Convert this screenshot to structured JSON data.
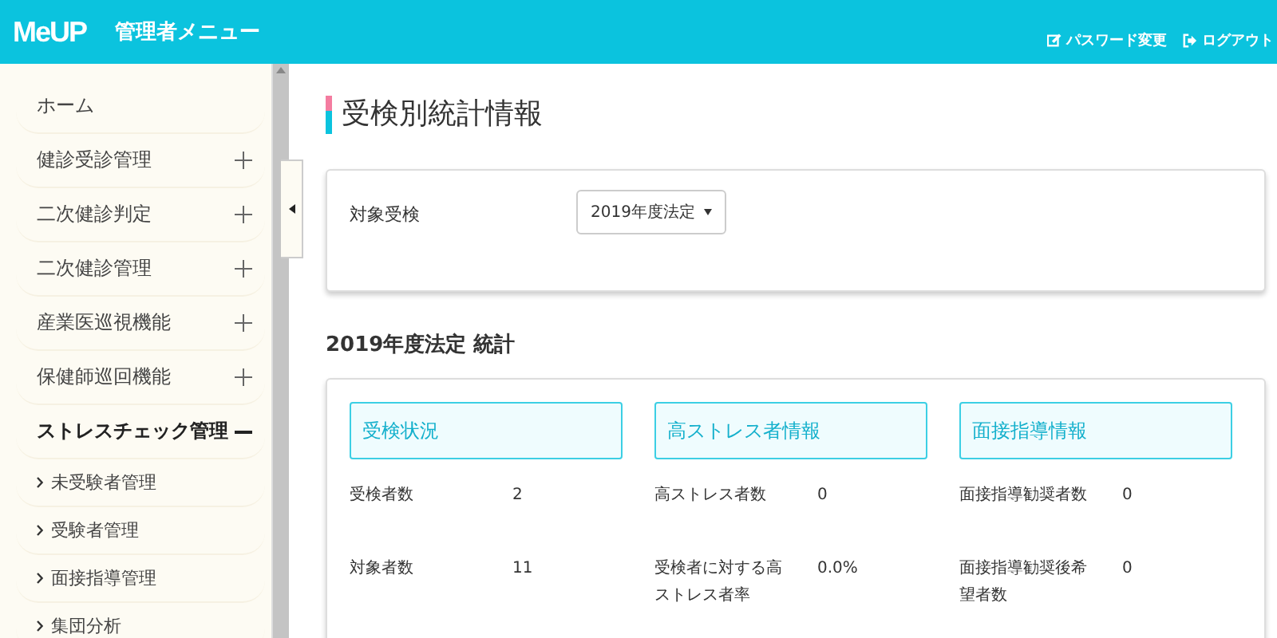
{
  "header": {
    "logo": "MeUP",
    "title": "管理者メニュー",
    "links": [
      {
        "kind": "password",
        "label": "パスワード変更"
      },
      {
        "kind": "logout",
        "label": "ログアウト"
      }
    ]
  },
  "sidebar": {
    "items": [
      {
        "kind": "item",
        "label": "ホーム"
      },
      {
        "kind": "group",
        "label": "健診受診管理",
        "expanded": false
      },
      {
        "kind": "group",
        "label": "二次健診判定",
        "expanded": false
      },
      {
        "kind": "group",
        "label": "二次健診管理",
        "expanded": false
      },
      {
        "kind": "group",
        "label": "産業医巡視機能",
        "expanded": false
      },
      {
        "kind": "group",
        "label": "保健師巡回機能",
        "expanded": false
      },
      {
        "kind": "group",
        "label": "ストレスチェック管理",
        "expanded": true,
        "children": [
          {
            "label": "未受験者管理"
          },
          {
            "label": "受験者管理"
          },
          {
            "label": "面接指導管理"
          },
          {
            "label": "集団分析"
          }
        ]
      }
    ]
  },
  "page": {
    "title": "受検別統計情報",
    "filter": {
      "label": "対象受検",
      "value": "2019年度法定"
    },
    "stats_title": "2019年度法定 統計",
    "columns": [
      {
        "heading": "受検状況",
        "rows": [
          {
            "label": "受検者数",
            "value": "2"
          },
          {
            "label": "対象者数",
            "value": "11"
          }
        ]
      },
      {
        "heading": "高ストレス者情報",
        "rows": [
          {
            "label": "高ストレス者数",
            "value": "0"
          },
          {
            "label": "受検者に対する高ストレス者率",
            "value": "0.0%"
          }
        ]
      },
      {
        "heading": "面接指導情報",
        "rows": [
          {
            "label": "面接指導勧奨者数",
            "value": "0"
          },
          {
            "label": "面接指導勧奨後希望者数",
            "value": "0"
          }
        ]
      }
    ]
  }
}
